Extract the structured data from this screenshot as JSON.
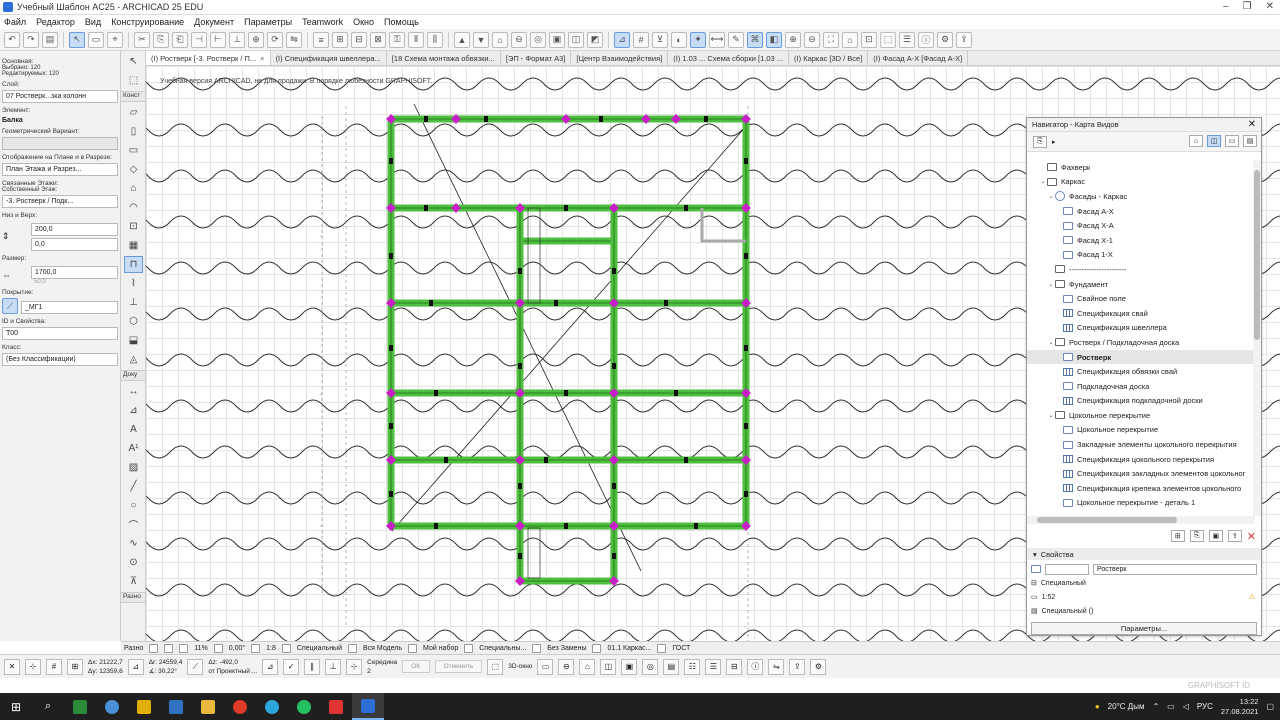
{
  "window": {
    "title": "Учебный Шаблон AC25 - ARCHICAD 25 EDU",
    "controls": [
      "–",
      "❐",
      "✕"
    ]
  },
  "menu": [
    "Файл",
    "Редактор",
    "Вид",
    "Конструирование",
    "Документ",
    "Параметры",
    "Teamwork",
    "Окно",
    "Помощь"
  ],
  "tabs": [
    {
      "label": "(I) Ростверк [-3. Ростверк / П...",
      "active": true
    },
    {
      "label": "(I) Спецификация швеллера...",
      "active": false
    },
    {
      "label": "[18 Схема монтажа обвязки...",
      "active": false
    },
    {
      "label": "[ЭП - Формат А3]",
      "active": false
    },
    {
      "label": "[Центр Взаимодействия]",
      "active": false
    },
    {
      "label": "(I) 1.03 ... Схема сборки [1.03 ...",
      "active": false
    },
    {
      "label": "(I) Каркас [3D / Все]",
      "active": false
    },
    {
      "label": "(I) Фасад А-Х [Фасад А-Х]",
      "active": false
    }
  ],
  "canvas": {
    "watermark": "Учебная версия ARCHICAD, не для продажи. В порядке любезности GRAPHISOFT."
  },
  "infobox": {
    "main_label": "Основная:",
    "selected": "Выбрано: 120",
    "editable": "Редактируемых: 120",
    "layer_label": "Слой:",
    "layer_value": "07 Ростверк...зка колонн",
    "element_label": "Элемент:",
    "element_value": "Балка",
    "geom_label": "Геометрический Вариант:",
    "display_label": "Отображение на Плане и в Разрезе:",
    "display_value": "План Этажа и Разрез...",
    "linked_label": "Связанные Этажи:",
    "own_story_label": "Собственный Этаж:",
    "own_story_value": "-3. Ростверк / Подк...",
    "top_bottom_label": "Низ и Верх:",
    "top_value": "200,0",
    "bottom_value": "0,0",
    "size_label": "Размер:",
    "size_value": "1700,0",
    "size_value2": "50,0",
    "cover_label": "Покрытие:",
    "cover_value": "_МГ1",
    "id_label": "ID и Свойства:",
    "id_value": "Т00",
    "class_label": "Класс:",
    "class_value": "(Без Классификации)"
  },
  "toolbox": {
    "group_construct": "Конст",
    "group_doc": "Доку",
    "group_other": "Разно"
  },
  "navigator": {
    "title": "Навигатор - Карта Видов",
    "tree": [
      {
        "label": "Фахверк",
        "indent": 1,
        "icon": "folder",
        "arrow": ""
      },
      {
        "label": "Каркас",
        "indent": 1,
        "icon": "folder",
        "arrow": "⌄"
      },
      {
        "label": "Фасады - Каркас",
        "indent": 2,
        "icon": "elev",
        "arrow": "⌄"
      },
      {
        "label": "Фасад А-Х",
        "indent": 3,
        "icon": "view",
        "arrow": ""
      },
      {
        "label": "Фасад Х-А",
        "indent": 3,
        "icon": "view",
        "arrow": ""
      },
      {
        "label": "Фасад Х-1",
        "indent": 3,
        "icon": "view",
        "arrow": ""
      },
      {
        "label": "Фасад 1-Х",
        "indent": 3,
        "icon": "view",
        "arrow": ""
      },
      {
        "label": "-----------------------",
        "indent": 2,
        "icon": "folder",
        "arrow": ""
      },
      {
        "label": "Фундамент",
        "indent": 2,
        "icon": "folder",
        "arrow": "⌄"
      },
      {
        "label": "Свайное поле",
        "indent": 3,
        "icon": "view",
        "arrow": ""
      },
      {
        "label": "Спецификация свай",
        "indent": 3,
        "icon": "grid",
        "arrow": ""
      },
      {
        "label": "Спецификация швеллера",
        "indent": 3,
        "icon": "grid",
        "arrow": ""
      },
      {
        "label": "Ростверк / Подкладочная доска",
        "indent": 2,
        "icon": "folder",
        "arrow": "⌄"
      },
      {
        "label": "Ростверк",
        "indent": 3,
        "icon": "view",
        "arrow": "",
        "selected": true
      },
      {
        "label": "Спецификация обвязки свай",
        "indent": 3,
        "icon": "grid",
        "arrow": ""
      },
      {
        "label": "Подкладочная доска",
        "indent": 3,
        "icon": "view",
        "arrow": ""
      },
      {
        "label": "Спецификация подкладочной доски",
        "indent": 3,
        "icon": "grid",
        "arrow": ""
      },
      {
        "label": "Цокольное перекрытие",
        "indent": 2,
        "icon": "folder",
        "arrow": "⌄"
      },
      {
        "label": "Цокольное перекрытие",
        "indent": 3,
        "icon": "view",
        "arrow": ""
      },
      {
        "label": "Закладные элементы цокольного перекрытия",
        "indent": 3,
        "icon": "view",
        "arrow": ""
      },
      {
        "label": "Спецификация цокольного перекрытия",
        "indent": 3,
        "icon": "grid",
        "arrow": ""
      },
      {
        "label": "Спецификация закладных элементов цокольног",
        "indent": 3,
        "icon": "grid",
        "arrow": ""
      },
      {
        "label": "Спецификация крепежа элементов цокольного",
        "indent": 3,
        "icon": "grid",
        "arrow": ""
      },
      {
        "label": "Цокольное перекрытие - деталь 1",
        "indent": 3,
        "icon": "view",
        "arrow": ""
      }
    ],
    "properties_header": "Свойства",
    "prop_name": "Ростверк",
    "prop_special": "Специальный",
    "prop_scale": "1:52",
    "prop_special2": "Специальный ()",
    "params_button": "Параметры..."
  },
  "viewbar": {
    "zoom": "11%",
    "angle": "0,00°",
    "scale": "1:8",
    "pen_set": "Специальный",
    "model": "Вся Модель",
    "my_set": "Мой набор",
    "special2": "Специальны...",
    "no_replace": "Без Замены",
    "frame": "01.1 Каркас...",
    "standard": "ГОСТ"
  },
  "coords": {
    "dx": "Δx: 21222,7",
    "dy": "Δy: 12359,6",
    "dr": "Δr: 24559,4",
    "angle": "∡: 30,22°",
    "dz": "Δz: -492,0",
    "from": "от Проектный ...",
    "snap": "Середина",
    "snap_n": "2",
    "ok": "OK",
    "cancel": "Отменить",
    "view3d": "3D-окно"
  },
  "taskbar": {
    "weather": "20°C Дым",
    "lang": "РУС",
    "time": "13:22",
    "date": "27.08.2021"
  },
  "graphisoft": "GRAPHISOFT ID",
  "colors": {
    "beam_green": "#4fbf3f",
    "node_magenta": "#c81ec8",
    "accent_blue": "#2c6ed5"
  }
}
